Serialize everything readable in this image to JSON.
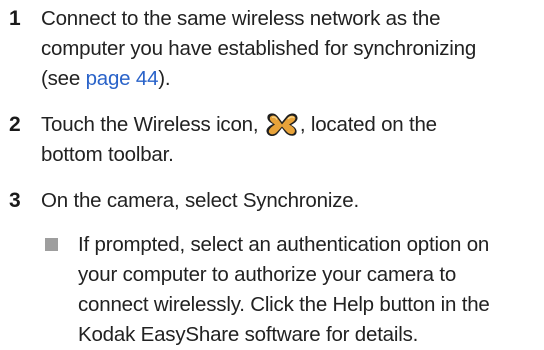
{
  "steps": [
    {
      "number": "1",
      "lines": [
        "Connect to the same wireless network as the",
        "computer you have established for synchronizing"
      ],
      "line3_prefix": "(see ",
      "line3_link": "page 44",
      "line3_suffix": ")."
    },
    {
      "number": "2",
      "line1_prefix": "Touch the Wireless icon,",
      "icon": "wireless-icon",
      "line1_suffix": ", located on the",
      "line2": "bottom toolbar."
    },
    {
      "number": "3",
      "text": "On the camera, select Synchronize."
    }
  ],
  "bullet": {
    "lines": [
      "If prompted, select an authentication option on",
      "your computer to authorize your camera to",
      "connect wirelessly. Click the Help button in the",
      "Kodak EasyShare software for details."
    ]
  },
  "colors": {
    "link": "#2a63c9",
    "bullet": "#9e9e9e",
    "icon_gold": "#e8a33a",
    "icon_dark": "#1f1f1f"
  }
}
